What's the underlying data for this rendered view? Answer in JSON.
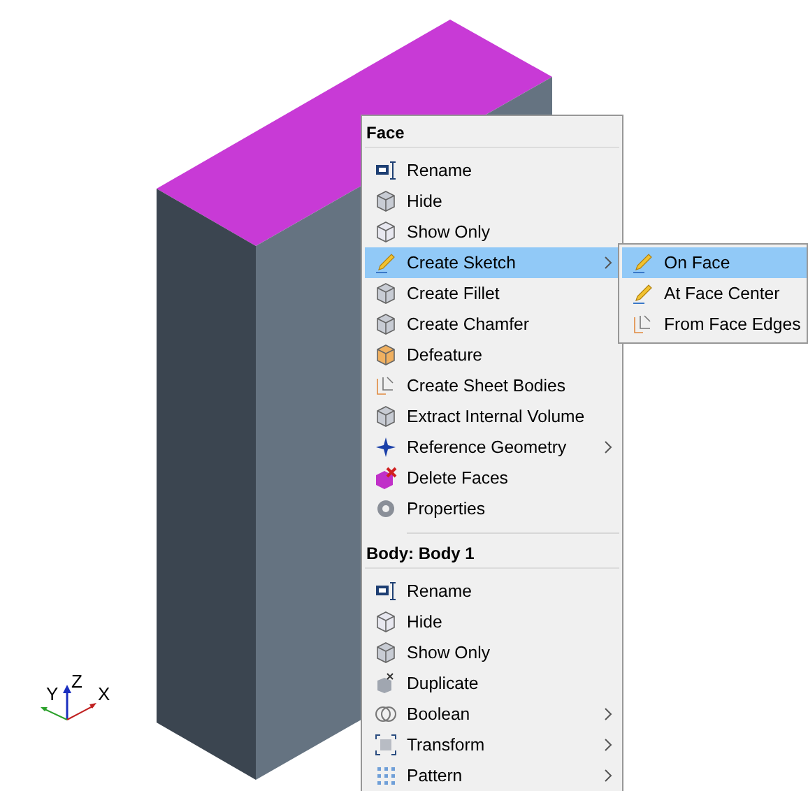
{
  "axis_labels": [
    "Y",
    "Z",
    "X"
  ],
  "context_menu": {
    "sections": [
      {
        "title": "Face",
        "items": [
          {
            "label": "Rename",
            "selected": false,
            "submenu": false
          },
          {
            "label": "Hide",
            "selected": false,
            "submenu": false
          },
          {
            "label": "Show Only",
            "selected": false,
            "submenu": false
          },
          {
            "label": "Create Sketch",
            "selected": true,
            "submenu": true
          },
          {
            "label": "Create Fillet",
            "selected": false,
            "submenu": false
          },
          {
            "label": "Create Chamfer",
            "selected": false,
            "submenu": false
          },
          {
            "label": "Defeature",
            "selected": false,
            "submenu": false
          },
          {
            "label": "Create Sheet Bodies",
            "selected": false,
            "submenu": false
          },
          {
            "label": "Extract Internal Volume",
            "selected": false,
            "submenu": false
          },
          {
            "label": "Reference Geometry",
            "selected": false,
            "submenu": true
          },
          {
            "label": "Delete Faces",
            "selected": false,
            "submenu": false
          },
          {
            "label": "Properties",
            "selected": false,
            "submenu": false
          }
        ]
      },
      {
        "title": "Body: Body 1",
        "items": [
          {
            "label": "Rename",
            "selected": false,
            "submenu": false
          },
          {
            "label": "Hide",
            "selected": false,
            "submenu": false
          },
          {
            "label": "Show Only",
            "selected": false,
            "submenu": false
          },
          {
            "label": "Duplicate",
            "selected": false,
            "submenu": false
          },
          {
            "label": "Boolean",
            "selected": false,
            "submenu": true
          },
          {
            "label": "Transform",
            "selected": false,
            "submenu": true
          },
          {
            "label": "Pattern",
            "selected": false,
            "submenu": true
          }
        ]
      }
    ]
  },
  "submenu": {
    "items": [
      {
        "label": "On Face",
        "selected": true
      },
      {
        "label": "At Face Center",
        "selected": false
      },
      {
        "label": "From Face Edges",
        "selected": false
      }
    ]
  }
}
